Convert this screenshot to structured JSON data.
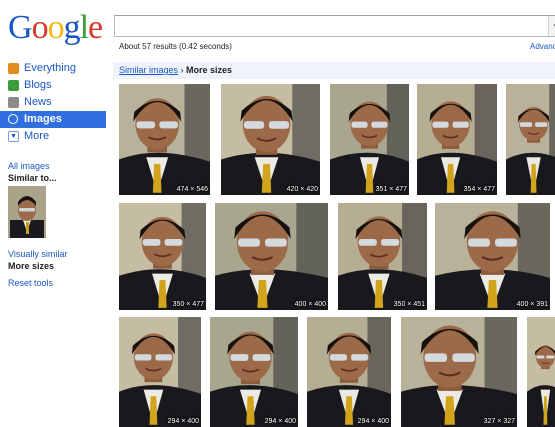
{
  "logo": {
    "text": "Google",
    "letters": [
      {
        "ch": "G",
        "color": "#1a57c4"
      },
      {
        "ch": "o",
        "color": "#d53a2c"
      },
      {
        "ch": "o",
        "color": "#f2b90e"
      },
      {
        "ch": "g",
        "color": "#1a57c4"
      },
      {
        "ch": "l",
        "color": "#3a9d3a"
      },
      {
        "ch": "e",
        "color": "#d53a2c"
      }
    ]
  },
  "search": {
    "value": "",
    "button_icon": "chevron-down-icon"
  },
  "results_stats": "About 57 results (0.42 seconds)",
  "advanced_link": "Advanced",
  "nav": [
    {
      "label": "Everything",
      "icon": "everything-icon",
      "icon_color": "#e38b1f",
      "active": false
    },
    {
      "label": "Blogs",
      "icon": "blogs-icon",
      "icon_color": "#3a9d3a",
      "active": false
    },
    {
      "label": "News",
      "icon": "news-icon",
      "icon_color": "#8a8a8a",
      "active": false
    },
    {
      "label": "Images",
      "icon": "images-icon",
      "icon_color": "#ffffff",
      "active": true
    },
    {
      "label": "More",
      "icon": "more-toggle-icon",
      "icon_color": "#1a57c4",
      "active": false
    }
  ],
  "sidebar": {
    "all_images": "All images",
    "similar_to": "Similar to...",
    "visually_similar": "Visually similar",
    "more_sizes": "More sizes",
    "reset_tools": "Reset tools"
  },
  "breadcrumb": {
    "link": "Similar images",
    "separator": "›",
    "current": "More sizes"
  },
  "images": [
    {
      "size": "474 × 546"
    },
    {
      "size": "420 × 420"
    },
    {
      "size": "351 × 477"
    },
    {
      "size": "354 × 477"
    },
    {
      "size": ""
    },
    {
      "size": "350 × 477"
    },
    {
      "size": "400 × 400"
    },
    {
      "size": "350 × 451"
    },
    {
      "size": "400 × 391"
    },
    {
      "size": "294 × 400"
    },
    {
      "size": "294 × 400"
    },
    {
      "size": "294 × 400"
    },
    {
      "size": "327 × 327"
    },
    {
      "size": ""
    }
  ]
}
